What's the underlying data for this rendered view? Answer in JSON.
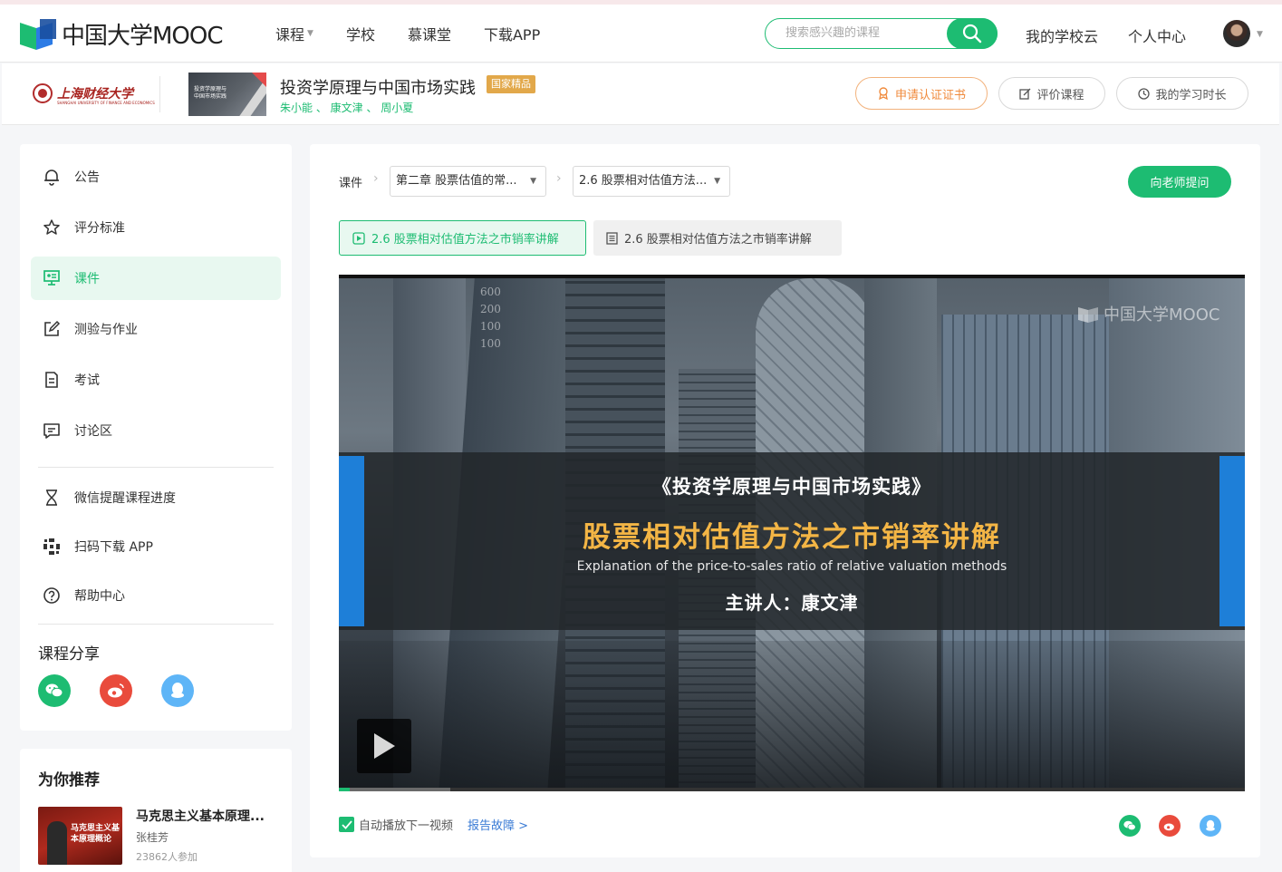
{
  "header": {
    "logo_text": "中国大学MOOC",
    "nav": [
      "课程",
      "学校",
      "慕课堂",
      "下载APP"
    ],
    "search_placeholder": "搜索感兴趣的课程",
    "school_cloud": "我的学校云",
    "personal_center": "个人中心"
  },
  "course": {
    "school_name": "上海财经大学",
    "school_sub": "SHANGHAI UNIVERSITY OF FINANCE AND ECONOMICS",
    "thumb_text": "投资学原理与中国市场实践",
    "title": "投资学原理与中国市场实践",
    "badge": "国家精品",
    "teachers": "朱小能 、 康文津 、 周小夏",
    "buttons": {
      "certificate": "申请认证证书",
      "rate": "评价课程",
      "study_time": "我的学习时长"
    }
  },
  "sidebar": {
    "items": [
      {
        "label": "公告"
      },
      {
        "label": "评分标准"
      },
      {
        "label": "课件"
      },
      {
        "label": "测验与作业"
      },
      {
        "label": "考试"
      },
      {
        "label": "讨论区"
      }
    ],
    "extra": [
      {
        "label": "微信提醒课程进度"
      },
      {
        "label": "扫码下载 APP"
      },
      {
        "label": "帮助中心"
      }
    ],
    "share_title": "课程分享"
  },
  "recommend": {
    "title": "为你推荐",
    "thumb_text": "马克思主义基本原理概论",
    "course_name": "马克思主义基本原理...",
    "teacher": "张桂芳",
    "count": "23862人参加"
  },
  "main": {
    "crumb": "课件",
    "chapter_select": "第二章 股票估值的常...",
    "lesson_select": "2.6 股票相对估值方法...",
    "ask_button": "向老师提问",
    "tabs": [
      {
        "label": "2.6 股票相对估值方法之市销率讲解",
        "kind": "video"
      },
      {
        "label": "2.6 股票相对估值方法之市销率讲解",
        "kind": "document"
      }
    ],
    "video": {
      "watermark": "中国大学MOOC",
      "ticker_numbers": [
        "600",
        "200",
        "100",
        "100"
      ],
      "subtitle": "《投资学原理与中国市场实践》",
      "title": "股票相对估值方法之市销率讲解",
      "english": "Explanation of the price-to-sales ratio of relative valuation methods",
      "lecturer": "主讲人：康文津",
      "progress_played": 0.012,
      "progress_buffered": 0.123
    },
    "autoplay_label": "自动播放下一视频",
    "report_label": "报告故障 >"
  },
  "colors": {
    "brand_green": "#1dbc72",
    "badge_gold": "#e2a84a",
    "cert_orange": "#f08a3c",
    "title_gold": "#f3b545"
  }
}
